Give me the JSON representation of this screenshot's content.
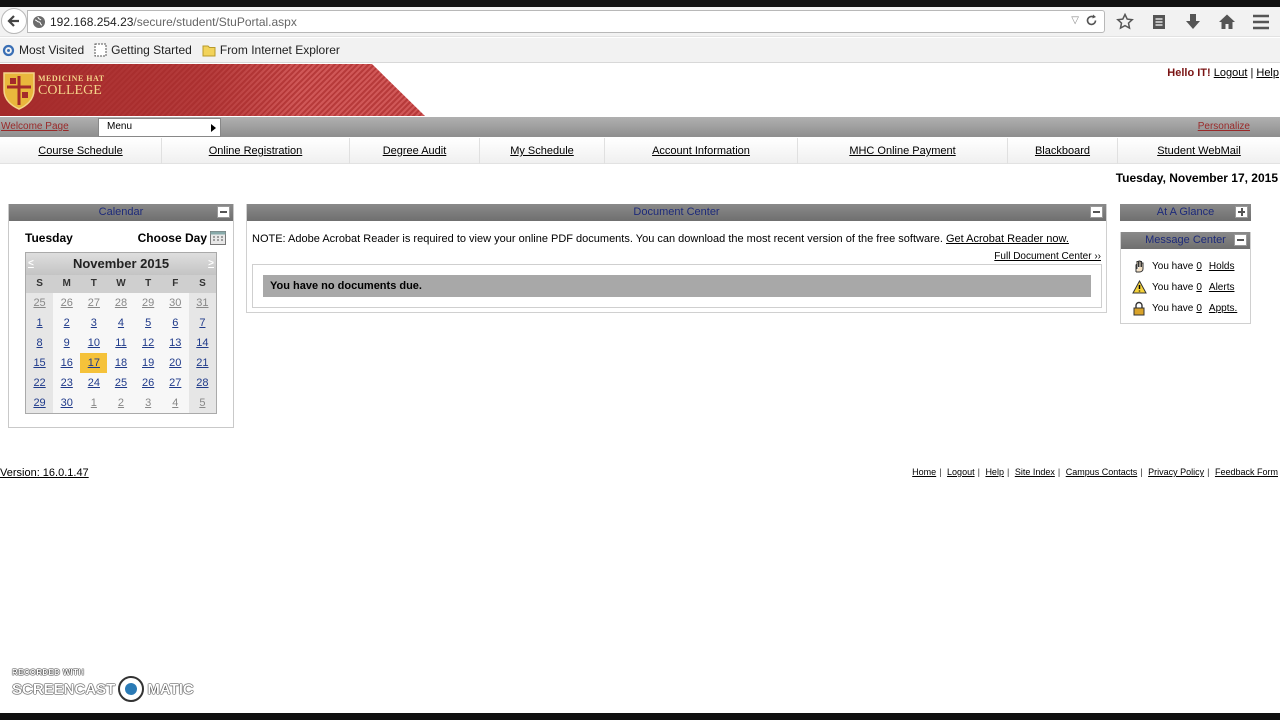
{
  "browser": {
    "url_host": "192.168.254.23",
    "url_path": "/secure/student/StuPortal.aspx"
  },
  "bookmarks": [
    {
      "label": "Most Visited",
      "icon": "gear-icon"
    },
    {
      "label": "Getting Started",
      "icon": "page-icon"
    },
    {
      "label": "From Internet Explorer",
      "icon": "folder-icon"
    }
  ],
  "header": {
    "logo_line1": "MEDICINE HAT",
    "logo_line2": "COLLEGE",
    "hello": "Hello IT!",
    "logout": "Logout",
    "help": "Help",
    "sep": "|"
  },
  "menubar": {
    "welcome": "Welcome Page",
    "menu_label": "Menu",
    "personalize": "Personalize"
  },
  "nav": [
    {
      "label": "Course Schedule"
    },
    {
      "label": "Online Registration"
    },
    {
      "label": "Degree Audit"
    },
    {
      "label": "My Schedule"
    },
    {
      "label": "Account Information"
    },
    {
      "label": "MHC Online Payment"
    },
    {
      "label": "Blackboard"
    },
    {
      "label": "Student WebMail"
    }
  ],
  "date_line": "Tuesday, November 17, 2015",
  "calendar": {
    "title": "Calendar",
    "day_name": "Tuesday",
    "choose_day": "Choose Day",
    "month": "November 2015",
    "prev": "<",
    "next": ">",
    "dow": [
      "S",
      "M",
      "T",
      "W",
      "T",
      "F",
      "S"
    ],
    "weeks": [
      [
        "25",
        "26",
        "27",
        "28",
        "29",
        "30",
        "31"
      ],
      [
        "1",
        "2",
        "3",
        "4",
        "5",
        "6",
        "7"
      ],
      [
        "8",
        "9",
        "10",
        "11",
        "12",
        "13",
        "14"
      ],
      [
        "15",
        "16",
        "17",
        "18",
        "19",
        "20",
        "21"
      ],
      [
        "22",
        "23",
        "24",
        "25",
        "26",
        "27",
        "28"
      ],
      [
        "29",
        "30",
        "1",
        "2",
        "3",
        "4",
        "5"
      ]
    ],
    "today": "17"
  },
  "documents": {
    "title": "Document Center",
    "note": "NOTE: Adobe Acrobat Reader is required to view your online PDF documents. You can download the most recent version of the free software.",
    "acrobat_link": "Get Acrobat Reader now.",
    "full_center": "Full Document Center ››",
    "empty_msg": "You have no documents due."
  },
  "glance": {
    "title": "At A Glance"
  },
  "messages": {
    "title": "Message Center",
    "rows": [
      {
        "prefix": "You have",
        "count": "0",
        "link": "Holds",
        "icon": "hand-icon"
      },
      {
        "prefix": "You have",
        "count": "0",
        "link": "Alerts",
        "icon": "warning-icon"
      },
      {
        "prefix": "You have",
        "count": "0",
        "link": "Appts.",
        "icon": "lock-icon"
      }
    ]
  },
  "footer": {
    "version": "Version: 16.0.1.47",
    "links": [
      "Home",
      "Logout",
      "Help",
      "Site Index",
      "Campus Contacts",
      "Privacy Policy",
      "Feedback Form"
    ]
  },
  "watermark": {
    "line1": "RECORDED WITH",
    "left": "SCREENCAST",
    "right": "MATIC"
  }
}
